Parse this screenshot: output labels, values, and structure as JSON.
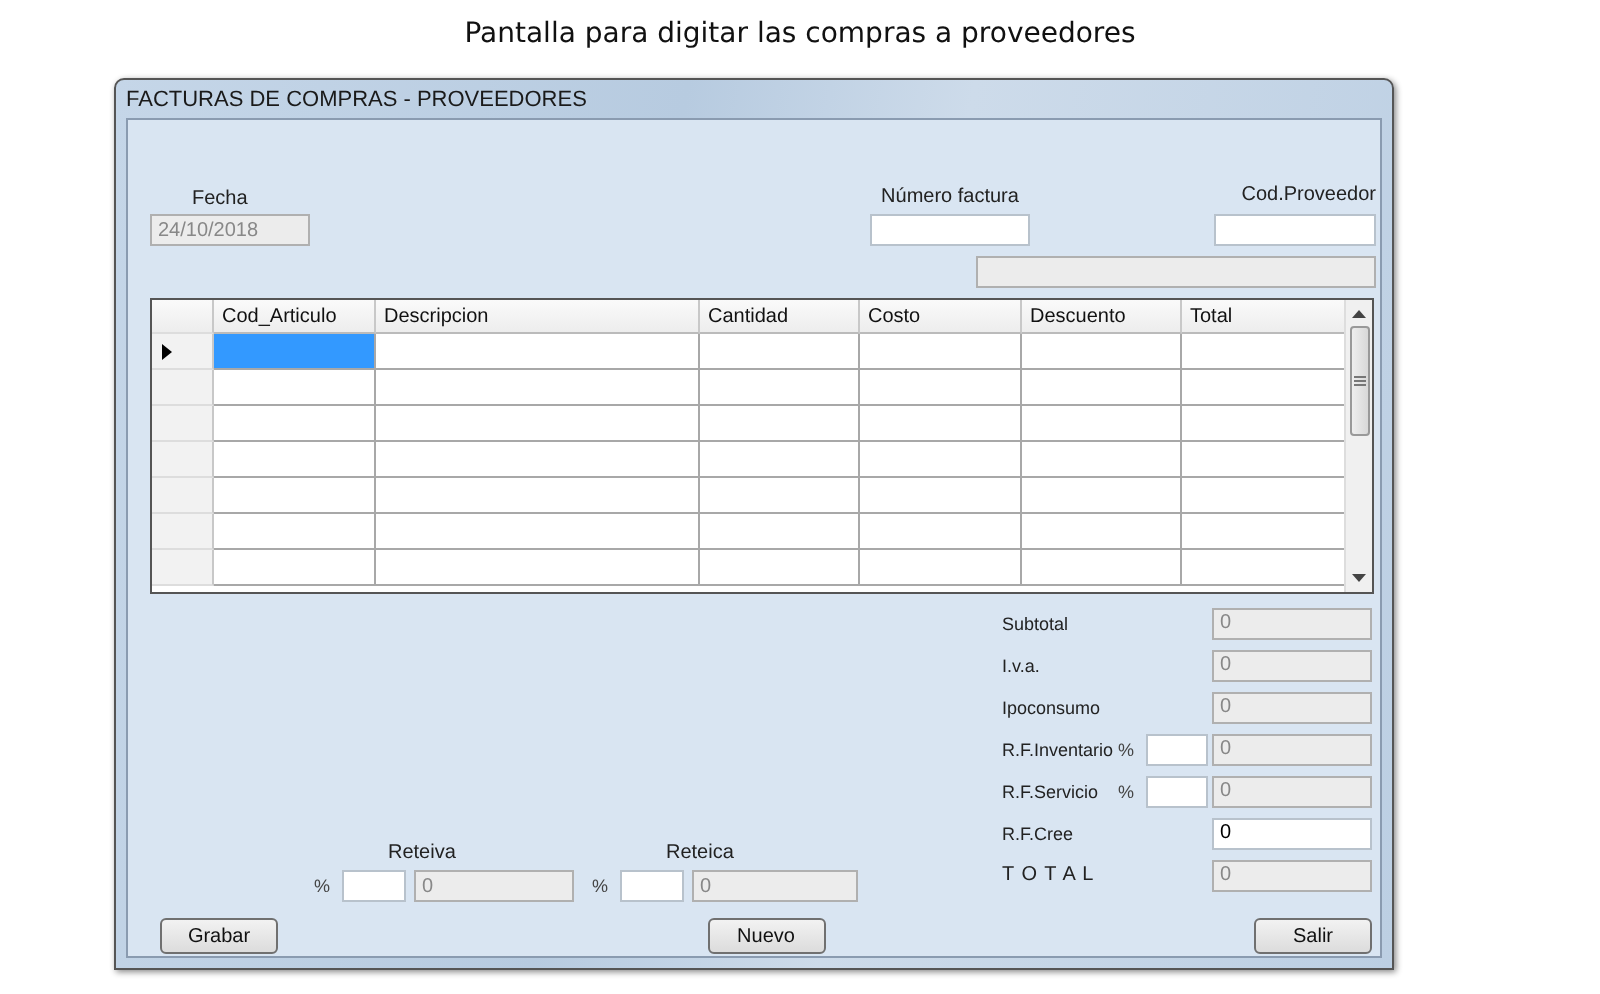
{
  "caption": "Pantalla para digitar las compras a proveedores",
  "window": {
    "title": "FACTURAS DE COMPRAS  - PROVEEDORES"
  },
  "fecha": {
    "label": "Fecha",
    "value": "24/10/2018",
    "disabled": true
  },
  "numero_factura": {
    "label": "Número factura",
    "disabled": false
  },
  "cod_proveedor": {
    "label": "Cod.Proveedor",
    "disabled": false
  },
  "proveedor_nombre": {
    "disabled": true
  },
  "table": {
    "columns": [
      "Cod_Articulo",
      "Descripcion",
      "Cantidad",
      "Costo",
      "Descuento",
      "Total"
    ],
    "rows": [
      {
        "current": true
      },
      {
        "current": false
      },
      {
        "current": false
      },
      {
        "current": false
      },
      {
        "current": false
      },
      {
        "current": false
      },
      {
        "current": false
      }
    ]
  },
  "totals": [
    {
      "kind": "plain",
      "label": "Subtotal",
      "value": "0",
      "disabled": true
    },
    {
      "kind": "plain",
      "label": "I.v.a.",
      "value": "0",
      "disabled": true
    },
    {
      "kind": "plain",
      "label": "Ipoconsumo",
      "value": "0",
      "disabled": true
    },
    {
      "kind": "percent",
      "label": "R.F.Inventario",
      "percent_label": "%",
      "value": "0",
      "disabled": true
    },
    {
      "kind": "percent",
      "label": "R.F.Servicio",
      "percent_label": "%",
      "value": "0",
      "disabled": true
    },
    {
      "kind": "plain",
      "label": "R.F.Cree",
      "value": "0",
      "disabled": false
    },
    {
      "kind": "total",
      "label": "T O T A L",
      "value": "0",
      "disabled": true
    }
  ],
  "retentions": [
    {
      "label": "Reteiva",
      "percent_label": "%",
      "value": "0"
    },
    {
      "label": "Reteica",
      "percent_label": "%",
      "value": "0"
    }
  ],
  "buttons": [
    "Grabar",
    "Nuevo",
    "Salir"
  ]
}
